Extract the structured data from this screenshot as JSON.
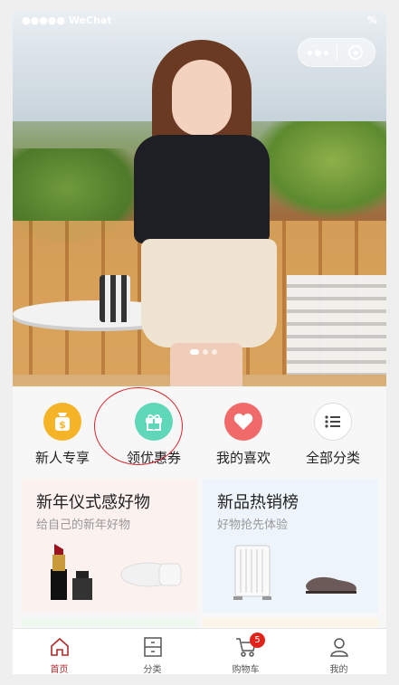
{
  "status_bar": {
    "carrier": "●●●●● WeChat",
    "time": "",
    "battery": "%"
  },
  "categories": [
    {
      "label": "新人专享",
      "icon": "money-bag-icon",
      "color": "#f5b428"
    },
    {
      "label": "领优惠券",
      "icon": "gift-icon",
      "color": "#5ed8b8"
    },
    {
      "label": "我的喜欢",
      "icon": "heart-icon",
      "color": "#f06a6a"
    },
    {
      "label": "全部分类",
      "icon": "list-icon",
      "color": "#ffffff"
    }
  ],
  "promos": [
    {
      "title": "新年仪式感好物",
      "subtitle": "给自己的新年好物",
      "bg": "#fbf1ee"
    },
    {
      "title": "新品热销榜",
      "subtitle": "好物抢先体验",
      "bg": "#eef4fb"
    }
  ],
  "tabbar": [
    {
      "label": "首页",
      "icon": "home-icon",
      "active": true
    },
    {
      "label": "分类",
      "icon": "category-icon",
      "active": false
    },
    {
      "label": "购物车",
      "icon": "cart-icon",
      "active": false,
      "badge": "5"
    },
    {
      "label": "我的",
      "icon": "user-icon",
      "active": false
    }
  ],
  "colors": {
    "accent": "#b02a2a",
    "badge": "#e2231a",
    "annotation_circle": "#d8232a"
  }
}
